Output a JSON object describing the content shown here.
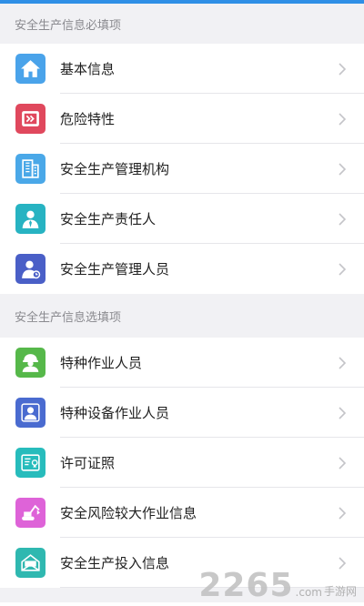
{
  "sections": [
    {
      "header": "安全生产信息必填项",
      "items": [
        {
          "label": "基本信息",
          "icon": "home-icon",
          "color": "#4aa3ea"
        },
        {
          "label": "危险特性",
          "icon": "hazard-sign-icon",
          "color": "#e0485d"
        },
        {
          "label": "安全生产管理机构",
          "icon": "building-icon",
          "color": "#4aa8e8"
        },
        {
          "label": "安全生产责任人",
          "icon": "person-tie-icon",
          "color": "#27b3c2"
        },
        {
          "label": "安全生产管理人员",
          "icon": "manager-person-icon",
          "color": "#4a5fc7"
        }
      ]
    },
    {
      "header": "安全生产信息选填项",
      "items": [
        {
          "label": "特种作业人员",
          "icon": "hardhat-worker-icon",
          "color": "#56b84a"
        },
        {
          "label": "特种设备作业人员",
          "icon": "operator-person-icon",
          "color": "#4a6bd0"
        },
        {
          "label": "许可证照",
          "icon": "certificate-icon",
          "color": "#27bcbc"
        },
        {
          "label": "安全风险较大作业信息",
          "icon": "excavator-icon",
          "color": "#de63d8"
        },
        {
          "label": "安全生产投入信息",
          "icon": "money-envelope-icon",
          "color": "#2fb8b0"
        }
      ]
    }
  ],
  "watermark": {
    "number": "2265",
    "suffix": ".com",
    "label": "手游网"
  },
  "colors": {
    "background": "#f1f1f4",
    "section_text": "#8a8a8f",
    "row_text": "#1f1f1f",
    "divider": "#e6e6ea",
    "chevron": "#c4c4c8"
  }
}
